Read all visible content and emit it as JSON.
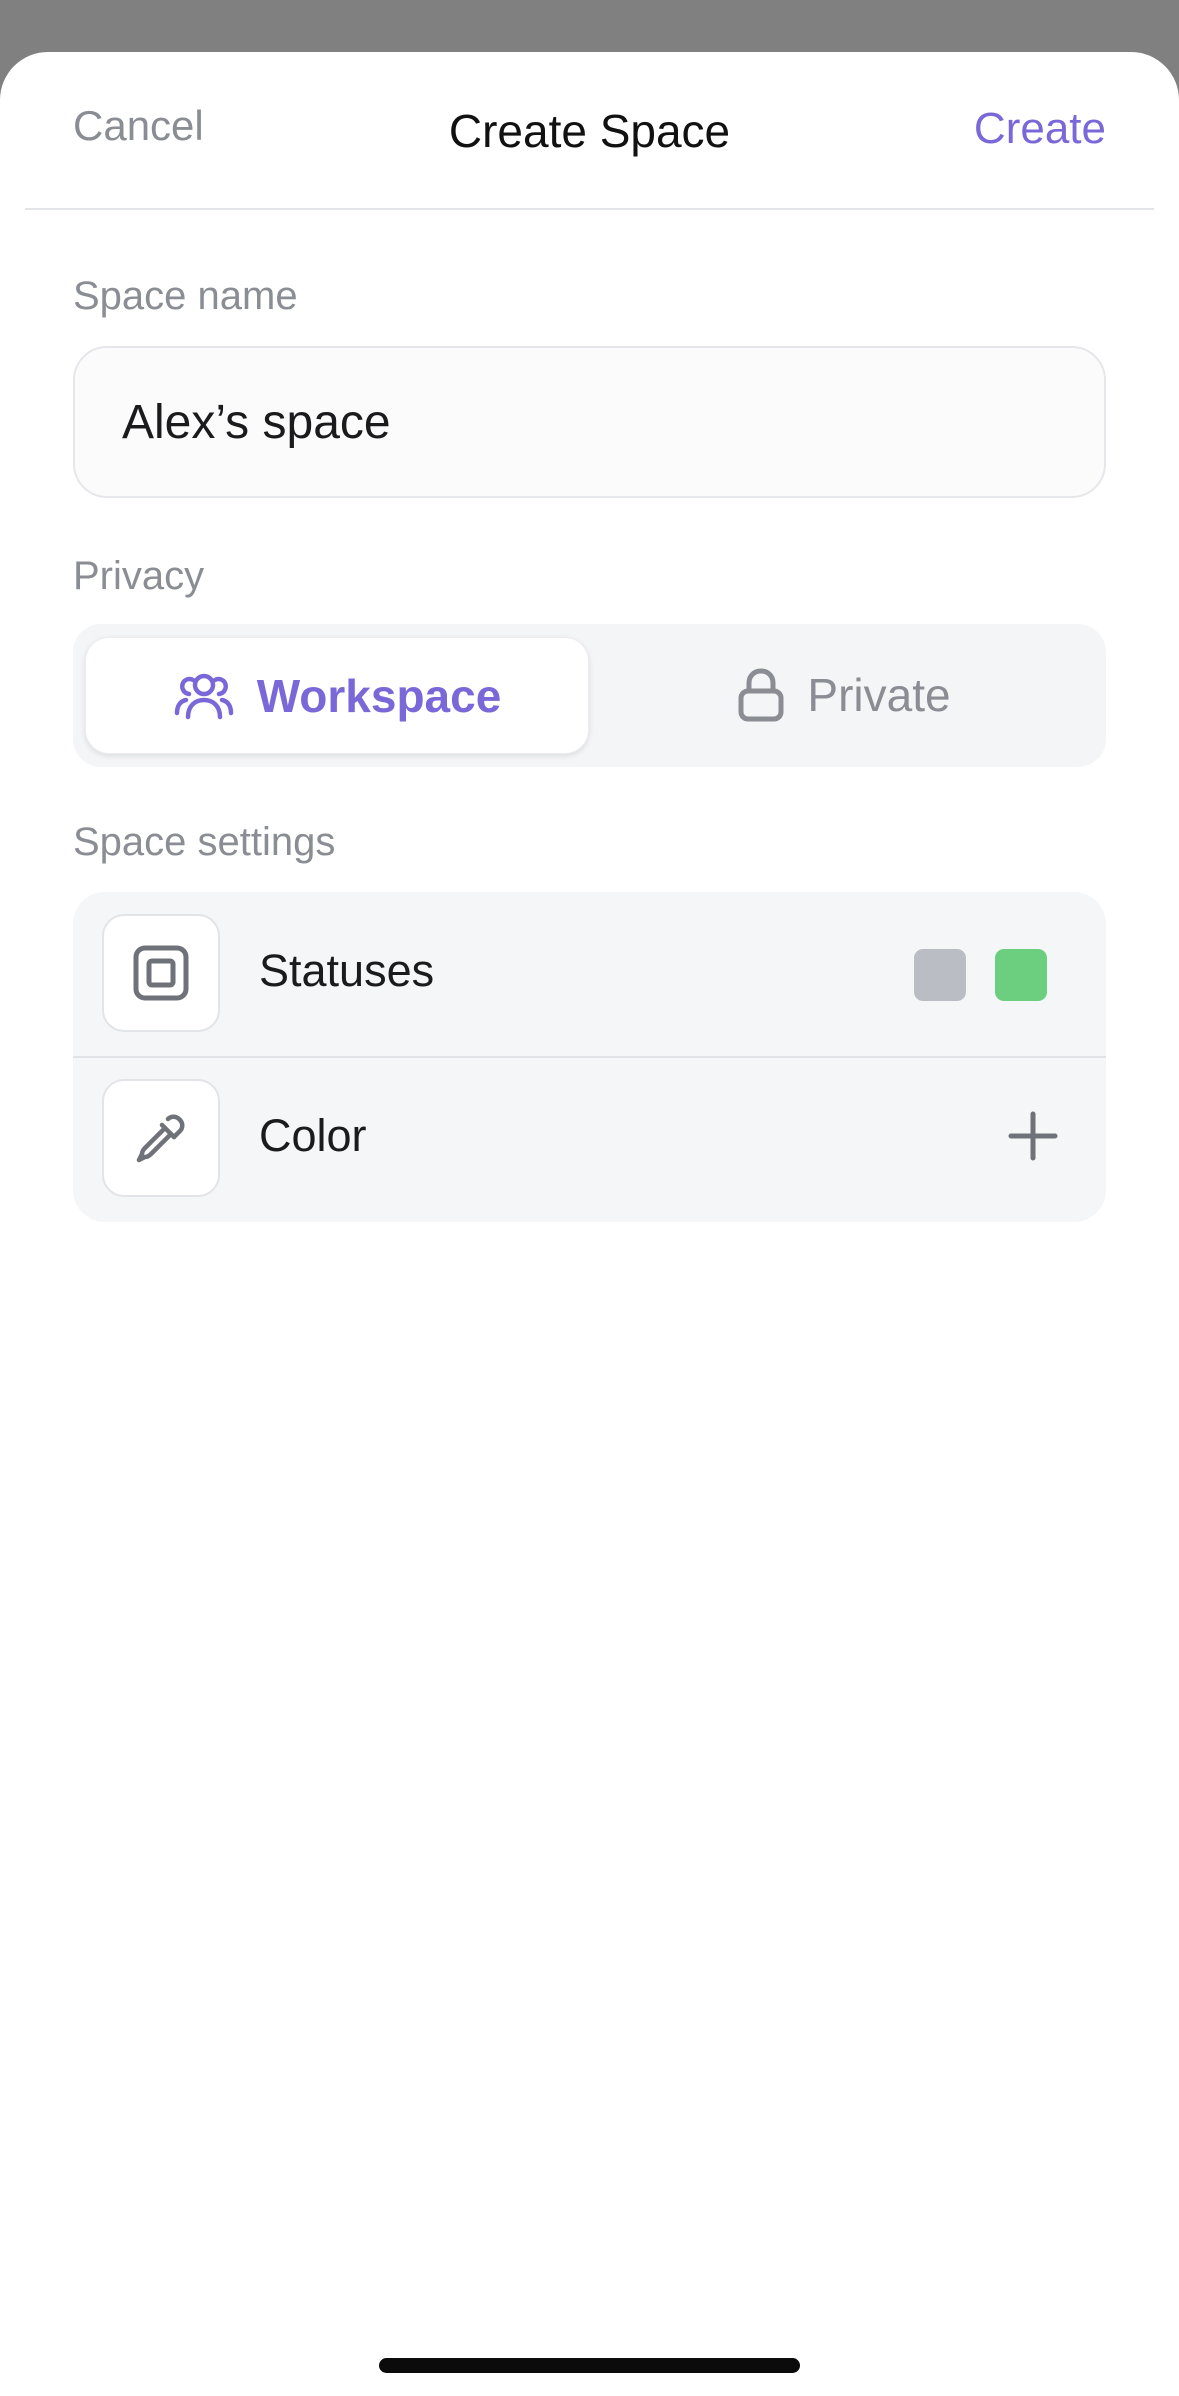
{
  "nav": {
    "cancel_label": "Cancel",
    "title": "Create Space",
    "create_label": "Create"
  },
  "space_name": {
    "label": "Space name",
    "value": "Alex’s space"
  },
  "privacy": {
    "label": "Privacy",
    "options": [
      {
        "label": "Workspace",
        "icon": "users-icon",
        "selected": true
      },
      {
        "label": "Private",
        "icon": "lock-icon",
        "selected": false
      }
    ]
  },
  "settings": {
    "label": "Space settings",
    "rows": [
      {
        "label": "Statuses",
        "icon": "statuses-icon",
        "swatches": [
          "#babec4",
          "#6ccf7f"
        ]
      },
      {
        "label": "Color",
        "icon": "eyedropper-icon",
        "action_icon": "plus-icon"
      }
    ]
  },
  "colors": {
    "accent": "#7b68d8",
    "muted_text": "#8a8d93",
    "backdrop": "#808080"
  }
}
